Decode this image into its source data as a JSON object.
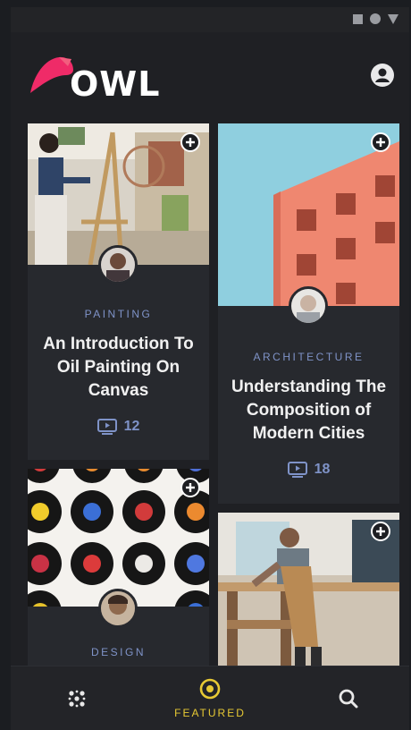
{
  "app": {
    "logo_text": "OWL"
  },
  "cards": [
    {
      "category": "PAINTING",
      "title": "An Introduction To Oil Painting On Canvas",
      "count": "12"
    },
    {
      "category": "ARCHITECTURE",
      "title": "Understanding The Composition of Modern Cities",
      "count": "18"
    },
    {
      "category": "DESIGN"
    }
  ],
  "nav": {
    "featured_label": "FEATURED"
  },
  "colors": {
    "accent": "#e7c934",
    "category": "#7f93c8",
    "logo_pink": "#ef2b68",
    "background": "#1f2024"
  }
}
